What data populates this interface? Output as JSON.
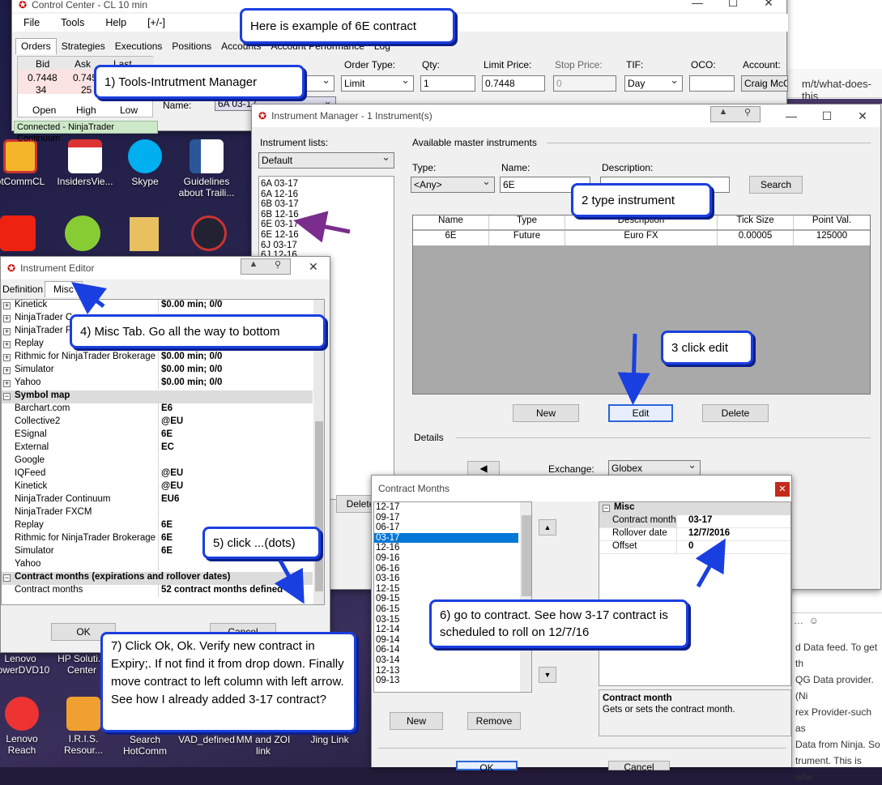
{
  "control_center": {
    "title": "Control Center - CL 10 min",
    "menu": [
      "File",
      "Tools",
      "Help",
      "[+/-]"
    ],
    "tabs": [
      "Orders",
      "Strategies",
      "Executions",
      "Positions",
      "Accounts",
      "Account Performance",
      "Log"
    ],
    "quote": {
      "bid_label": "Bid",
      "ask_label": "Ask",
      "last_label": "Last",
      "bid": "0.7448",
      "ask": "0.745",
      "bid_size": "34",
      "ask_size": "25",
      "open_label": "Open",
      "high_label": "High",
      "low_label": "Low"
    },
    "order": {
      "order_type_label": "Order Type:",
      "qty_label": "Qty:",
      "limit_label": "Limit Price:",
      "stop_label": "Stop Price:",
      "tif_label": "TIF:",
      "oco_label": "OCO:",
      "account_label": "Account:",
      "order_type": "Limit",
      "qty": "1",
      "limit": "0.7448",
      "stop": "0",
      "tif": "Day",
      "account": "Craig McC",
      "name_label": "Name:",
      "name": "6A 03-17"
    },
    "status": "Connected - NinjaTrader Continuum"
  },
  "instrument_manager": {
    "title": "Instrument Manager - 1 Instrument(s)",
    "lists_label": "Instrument lists:",
    "list_selected": "Default",
    "list_items": [
      "6A 03-17",
      "6A 12-16",
      "6B 03-17",
      "6B 12-16",
      "6E 03-17",
      "6E 12-16",
      "6J 03-17",
      "6J 12-16"
    ],
    "available_label": "Available master instruments",
    "type_label": "Type:",
    "type_value": "<Any>",
    "name_label": "Name:",
    "name_value": "6E",
    "desc_label": "Description:",
    "search_button": "Search",
    "grid_headers": [
      "Name",
      "Type",
      "Description",
      "Tick Size",
      "Point Val."
    ],
    "grid_row": [
      "6E",
      "Future",
      "Euro FX",
      "0.00005",
      "125000"
    ],
    "new_button": "New",
    "edit_button": "Edit",
    "delete_button": "Delete",
    "details_label": "Details",
    "exchange_label": "Exchange:",
    "exchange_value": "Globex",
    "delete_left": "Delete"
  },
  "instrument_editor": {
    "title": "Instrument Editor",
    "tab_definition": "Definition",
    "tab_misc": "Misc",
    "top_rows": [
      [
        "Kinetick",
        "$0.00 min;  0/0"
      ],
      [
        "NinjaTrader C",
        ""
      ],
      [
        "NinjaTrader F",
        ""
      ],
      [
        "Replay",
        ""
      ],
      [
        "Rithmic for NinjaTrader Brokerage",
        "$0.00 min;  0/0"
      ],
      [
        "Simulator",
        "$0.00 min;  0/0"
      ],
      [
        "Yahoo",
        "$0.00 min;  0/0"
      ]
    ],
    "symbol_map_label": "Symbol map",
    "symbol_rows": [
      [
        "Barchart.com",
        "E6"
      ],
      [
        "Collective2",
        "@EU"
      ],
      [
        "ESignal",
        "6E"
      ],
      [
        "External",
        "EC"
      ],
      [
        "Google",
        ""
      ],
      [
        "IQFeed",
        "@EU"
      ],
      [
        "Kinetick",
        "@EU"
      ],
      [
        "NinjaTrader Continuum",
        "EU6"
      ],
      [
        "NinjaTrader FXCM",
        ""
      ],
      [
        "Replay",
        "6E"
      ],
      [
        "Rithmic for NinjaTrader Brokerage",
        "6E"
      ],
      [
        "Simulator",
        "6E"
      ],
      [
        "Yahoo",
        ""
      ]
    ],
    "contract_cat": "Contract months (expirations and rollover dates)",
    "contract_row": [
      "Contract months",
      "52 contract months defined"
    ],
    "ok_button": "OK",
    "cancel_button": "Cancel"
  },
  "contract_months": {
    "title": "Contract Months",
    "months": [
      "12-17",
      "09-17",
      "06-17",
      "03-17",
      "12-16",
      "09-16",
      "06-16",
      "03-16",
      "12-15",
      "09-15",
      "06-15",
      "03-15",
      "12-14",
      "09-14",
      "06-14",
      "03-14",
      "12-13",
      "09-13"
    ],
    "selected": "03-17",
    "misc_label": "Misc",
    "props": [
      [
        "Contract month",
        "03-17"
      ],
      [
        "Rollover date",
        "12/7/2016"
      ],
      [
        "Offset",
        "0"
      ]
    ],
    "help_title": "Contract month",
    "help_text": "Gets or sets the contract month.",
    "new_button": "New",
    "remove_button": "Remove",
    "ok_button": "OK",
    "cancel_button": "Cancel"
  },
  "callouts": {
    "c0": "Here is example of 6E contract",
    "c1": "1) Tools-Intrutment Manager",
    "c2": "2 type instrument",
    "c3": "3 click edit",
    "c4": "4) Misc Tab. Go all the way to bottom",
    "c5": "5) click ...(dots)",
    "c6": "6) go to contract. See how 3-17  contract is scheduled to roll on 12/7/16",
    "c7": "7) Click Ok, Ok. Verify new contract in Expiry;. If not find it from drop down. Finally move contract to left column with left arrow. See how I already added 3-17 contract?"
  },
  "desktop_icons": [
    "otCommCL",
    "InsidersVie...",
    "Skype",
    "Guidelines about Traili...",
    "Lenovo PowerDVD10",
    "HP Soluti... Center",
    "Lenovo Reach",
    "I.R.I.S. Resour...",
    "Search HotComm",
    "VAD_defined",
    "MM and ZOI link",
    "Jing Link"
  ],
  "browser_snippets": {
    "url": "m/t/what-does-this",
    "lines": [
      "d Data feed. To get th",
      "QG Data provider.(Ni",
      "rex Provider-such as",
      "Data from Ninja. So",
      "trument. This is whe"
    ]
  },
  "colors": {
    "callout_border": "#1a3fe0",
    "arrow": "#1a3fe0",
    "purple_arrow": "#7a2d8c",
    "selection": "#0078d7",
    "close_red": "#c42b1c"
  }
}
